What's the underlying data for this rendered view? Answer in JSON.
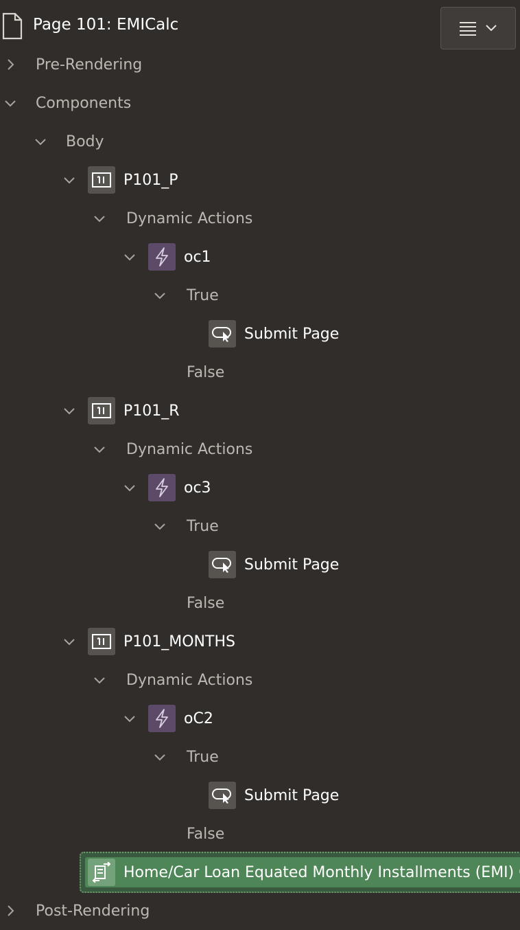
{
  "page_title": "Page 101: EMICalc",
  "tree": {
    "pre_rendering": "Pre-Rendering",
    "components": "Components",
    "body": "Body",
    "items": [
      {
        "name": "P101_P",
        "dynamic_actions": "Dynamic Actions",
        "action_name": "oc1",
        "true_label": "True",
        "true_action": "Submit Page",
        "false_label": "False"
      },
      {
        "name": "P101_R",
        "dynamic_actions": "Dynamic Actions",
        "action_name": "oc3",
        "true_label": "True",
        "true_action": "Submit Page",
        "false_label": "False"
      },
      {
        "name": "P101_MONTHS",
        "dynamic_actions": "Dynamic Actions",
        "action_name": "oC2",
        "true_label": "True",
        "true_action": "Submit Page",
        "false_label": "False"
      }
    ],
    "process": "Home/Car Loan Equated Monthly Installments (EMI) C",
    "post_rendering": "Post-Rendering"
  },
  "colors": {
    "background": "#312d2a",
    "item_badge": "#57534f",
    "dynamic_action_badge": "#5c4a68",
    "selected_row": "#4e8658"
  },
  "icons": {
    "page": "page-icon",
    "menu": "hamburger-menu-icon",
    "item": "page-item-icon",
    "dynamic_action": "lightning-icon",
    "action": "submit-page-icon",
    "process": "process-icon"
  }
}
